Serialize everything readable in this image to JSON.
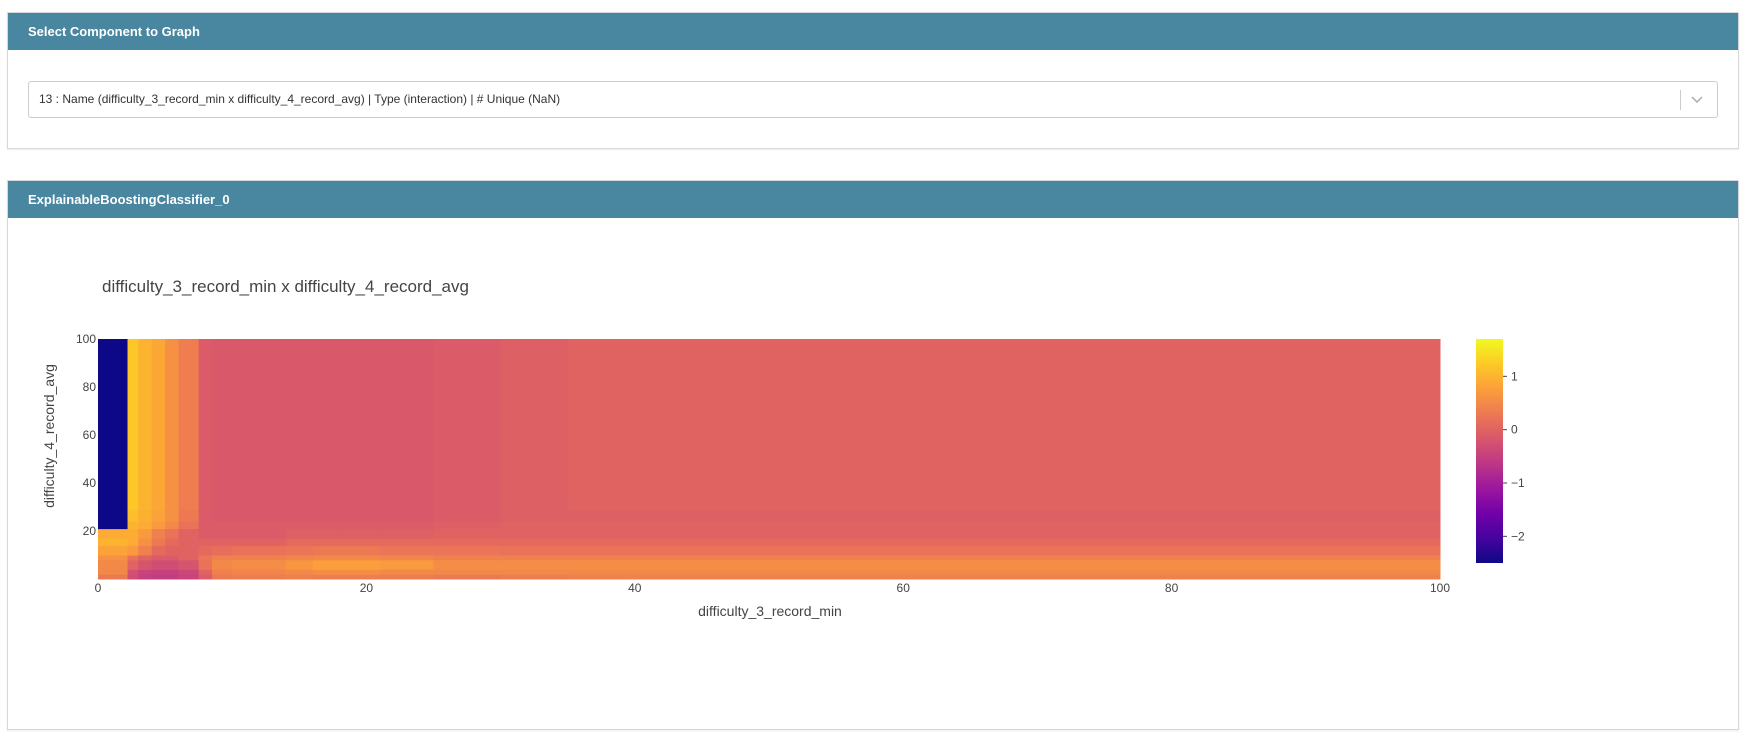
{
  "select_panel": {
    "header": "Select Component to Graph",
    "dropdown_value": "13 : Name (difficulty_3_record_min x difficulty_4_record_avg) | Type (interaction) | # Unique (NaN)"
  },
  "graph_panel": {
    "header": "ExplainableBoostingClassifier_0"
  },
  "colors": {
    "header_bg": "#49869f",
    "colorscale": [
      "#0d0887",
      "#46039f",
      "#7201a8",
      "#9c179e",
      "#bd3786",
      "#d8576b",
      "#ed7953",
      "#fb9f3a",
      "#fdca26",
      "#f0f921"
    ]
  },
  "chart_data": {
    "type": "heatmap",
    "title": "difficulty_3_record_min x difficulty_4_record_avg",
    "xlabel": "difficulty_3_record_min",
    "ylabel": "difficulty_4_record_avg",
    "xlim": [
      0,
      100
    ],
    "ylim": [
      0,
      100
    ],
    "xticks": [
      0,
      20,
      40,
      60,
      80,
      100
    ],
    "yticks": [
      20,
      40,
      60,
      80,
      100
    ],
    "colorbar": {
      "min": -2.5,
      "max": 1.7,
      "ticks": [
        1,
        0,
        -1,
        -2
      ],
      "tick_labels": [
        "1",
        "0",
        "−1",
        "−2"
      ]
    },
    "x_edges": [
      0,
      2.2,
      3.0,
      4.0,
      5.0,
      6.0,
      7.5,
      8.5,
      10,
      14,
      16,
      18,
      21,
      25,
      30,
      35,
      100
    ],
    "y_edges": [
      0,
      2,
      4,
      8,
      10,
      14,
      17,
      21,
      24,
      29,
      100
    ],
    "z": [
      [
        0.3,
        -0.3,
        -0.5,
        -0.55,
        -0.55,
        -0.45,
        -0.1,
        0.3,
        0.35,
        0.4,
        0.35,
        0.35,
        0.35,
        0.3,
        0.35,
        0.4
      ],
      [
        0.5,
        -0.25,
        -0.45,
        -0.5,
        -0.5,
        -0.4,
        0.0,
        0.4,
        0.45,
        0.5,
        0.55,
        0.55,
        0.5,
        0.5,
        0.5,
        0.5
      ],
      [
        0.5,
        0.0,
        -0.2,
        -0.3,
        -0.3,
        -0.2,
        0.2,
        0.5,
        0.55,
        0.65,
        0.75,
        0.75,
        0.7,
        0.55,
        0.55,
        0.55
      ],
      [
        0.6,
        0.2,
        0.0,
        -0.1,
        -0.1,
        0.0,
        0.25,
        0.4,
        0.4,
        0.45,
        0.5,
        0.5,
        0.45,
        0.4,
        0.4,
        0.4
      ],
      [
        0.8,
        0.7,
        0.4,
        0.1,
        0.0,
        0.0,
        0.1,
        0.15,
        0.2,
        0.25,
        0.3,
        0.3,
        0.25,
        0.25,
        0.2,
        0.2
      ],
      [
        1.0,
        0.9,
        0.6,
        0.3,
        0.1,
        0.0,
        0.0,
        0.0,
        0.0,
        0.1,
        0.1,
        0.1,
        0.1,
        0.1,
        0.1,
        0.1
      ],
      [
        0.9,
        0.9,
        0.7,
        0.4,
        0.2,
        0.0,
        -0.1,
        -0.1,
        -0.1,
        -0.05,
        -0.05,
        -0.05,
        -0.05,
        0.0,
        0.0,
        0.0
      ],
      [
        -2.5,
        1.0,
        0.9,
        0.7,
        0.5,
        0.2,
        -0.1,
        -0.1,
        -0.1,
        -0.1,
        -0.1,
        -0.1,
        -0.1,
        -0.05,
        0.0,
        0.0
      ],
      [
        -2.5,
        1.1,
        0.95,
        0.8,
        0.6,
        0.3,
        -0.1,
        -0.15,
        -0.15,
        -0.15,
        -0.15,
        -0.15,
        -0.15,
        -0.1,
        -0.05,
        -0.05
      ],
      [
        -2.5,
        1.2,
        1.0,
        0.85,
        0.6,
        0.35,
        -0.1,
        -0.15,
        -0.15,
        -0.15,
        -0.15,
        -0.15,
        -0.15,
        -0.1,
        -0.05,
        0.0
      ]
    ]
  }
}
